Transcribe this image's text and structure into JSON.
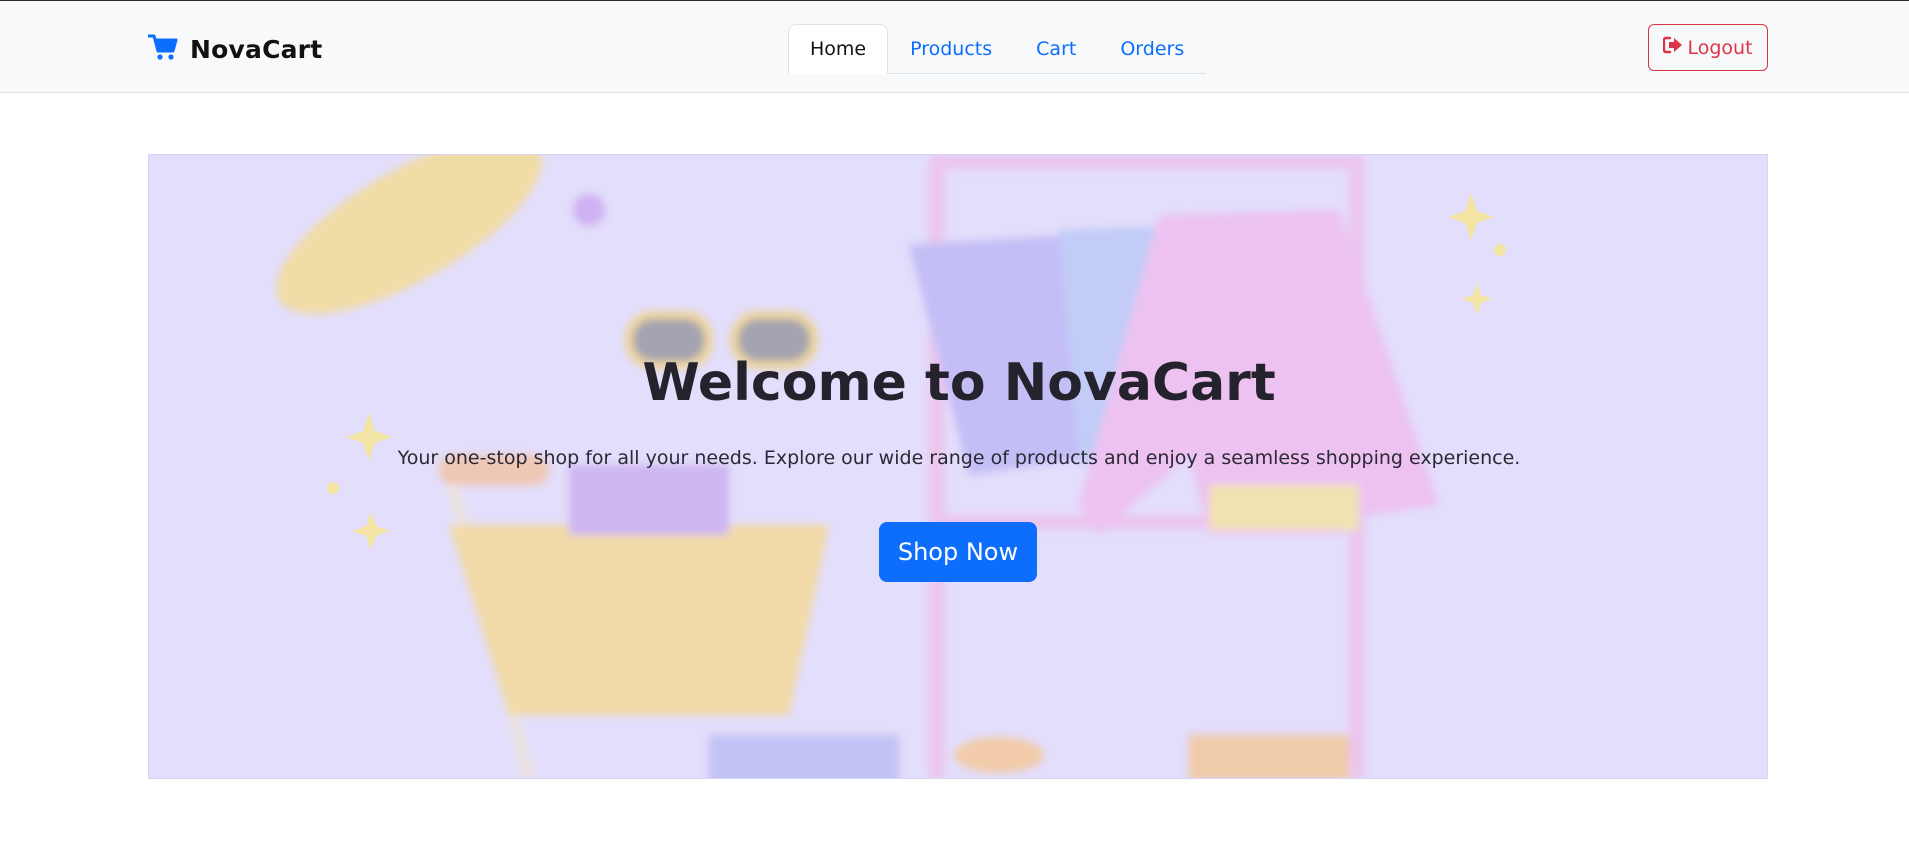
{
  "brand": {
    "name": "NovaCart",
    "icon": "cart-icon",
    "icon_color": "#0d6efd"
  },
  "nav": {
    "tabs": [
      {
        "label": "Home",
        "active": true
      },
      {
        "label": "Products",
        "active": false
      },
      {
        "label": "Cart",
        "active": false
      },
      {
        "label": "Orders",
        "active": false
      }
    ]
  },
  "header": {
    "logout_label": "Logout",
    "logout_icon": "sign-out-icon",
    "logout_color": "#dc3545"
  },
  "hero": {
    "title": "Welcome to NovaCart",
    "subtitle": "Your one-stop shop for all your needs. Explore our wide range of products and enjoy a seamless shopping experience.",
    "cta_label": "Shop Now",
    "cta_color": "#0d6efd",
    "background_color": "#e3defb"
  }
}
